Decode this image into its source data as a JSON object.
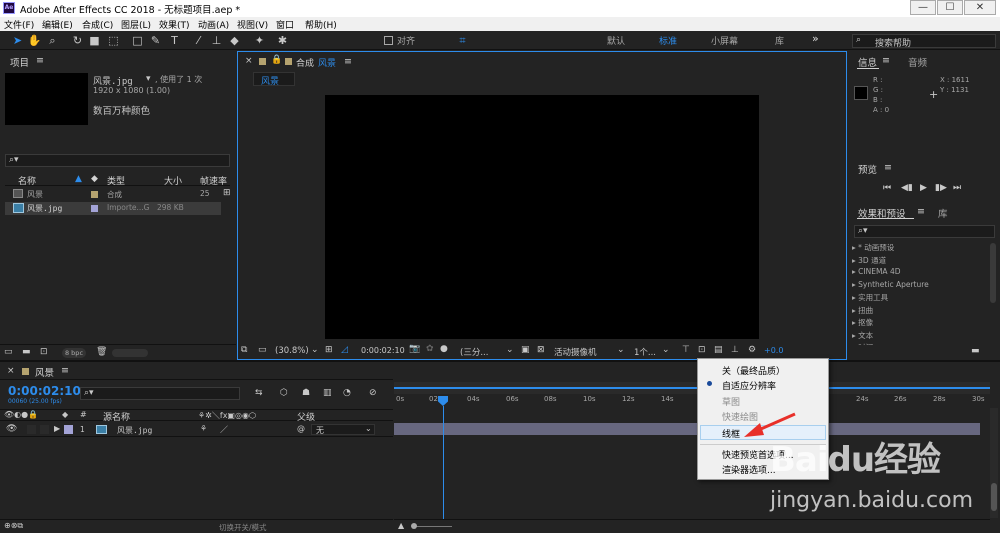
{
  "window": {
    "title": "Adobe After Effects CC 2018 - 无标题项目.aep *",
    "logo": "Ae",
    "min": "—",
    "max": "☐",
    "close": "✕"
  },
  "menu": [
    "文件(F)",
    "编辑(E)",
    "合成(C)",
    "图层(L)",
    "效果(T)",
    "动画(A)",
    "视图(V)",
    "窗口",
    "帮助(H)"
  ],
  "toolbar": {
    "align_label": "对齐",
    "workspaces": [
      "默认",
      "标准",
      "小屏幕",
      "库"
    ],
    "active_workspace": "标准",
    "more": "»",
    "search_placeholder": "搜索帮助"
  },
  "project": {
    "title": "项目",
    "selected_name": "风景.jpg",
    "used": ", 使用了 1 次",
    "size": "1920 x 1080 (1.00)",
    "colors": "数百万种颜色",
    "columns": {
      "name": "名称",
      "type": "类型",
      "size": "大小",
      "fps": "帧速率"
    },
    "rows": [
      {
        "name": "风景",
        "type": "合成",
        "size": "",
        "fps": "25"
      },
      {
        "name": "风景.jpg",
        "type": "Importe...G",
        "size": "298 KB",
        "fps": ""
      }
    ],
    "bpc": "8 bpc"
  },
  "composition": {
    "tab_prefix": "合成",
    "tab_name": "风景",
    "sub_tab": "风景",
    "zoom": "(30.8%)",
    "timecode": "0:00:02:10",
    "resolution": "(三分...",
    "camera": "活动摄像机",
    "views": "1个...",
    "exposure": "+0.0"
  },
  "info": {
    "tab_info": "信息",
    "tab_audio": "音频",
    "r": "R :",
    "g": "G :",
    "b": "B :",
    "a": "A : 0",
    "x": "X : 1611",
    "y": "Y : 1131"
  },
  "preview": {
    "title": "预览"
  },
  "effects": {
    "tab_effects": "效果和预设",
    "tab_library": "库",
    "items": [
      "* 动画预设",
      "3D 通道",
      "CINEMA 4D",
      "Synthetic Aperture",
      "实用工具",
      "扭曲",
      "抠像",
      "文本",
      "时间"
    ]
  },
  "timeline": {
    "comp_name": "风景",
    "timecode": "0:00:02:10",
    "frames": "00060 (25.00 fps)",
    "col_source": "源名称",
    "col_parent": "父级",
    "layer_index": "1",
    "layer_name": "风景.jpg",
    "parent_value": "无",
    "ruler": [
      "0s",
      "02s",
      "04s",
      "06s",
      "08s",
      "10s",
      "12s",
      "14s",
      "24s",
      "26s",
      "28s",
      "30s"
    ],
    "switch_mode": "切换开关/模式"
  },
  "dropdown": {
    "items": [
      "关（最终品质）",
      "自适应分辨率",
      "草图",
      "快速绘图",
      "线框",
      "快速预览首选项...",
      "渲染器选项..."
    ]
  },
  "watermark": {
    "brand": "Baidu经验",
    "url": "jingyan.baidu.com"
  },
  "colors": {
    "accent": "#2d8ceb",
    "bg": "#232323",
    "panel_border": "#2d8ceb"
  }
}
